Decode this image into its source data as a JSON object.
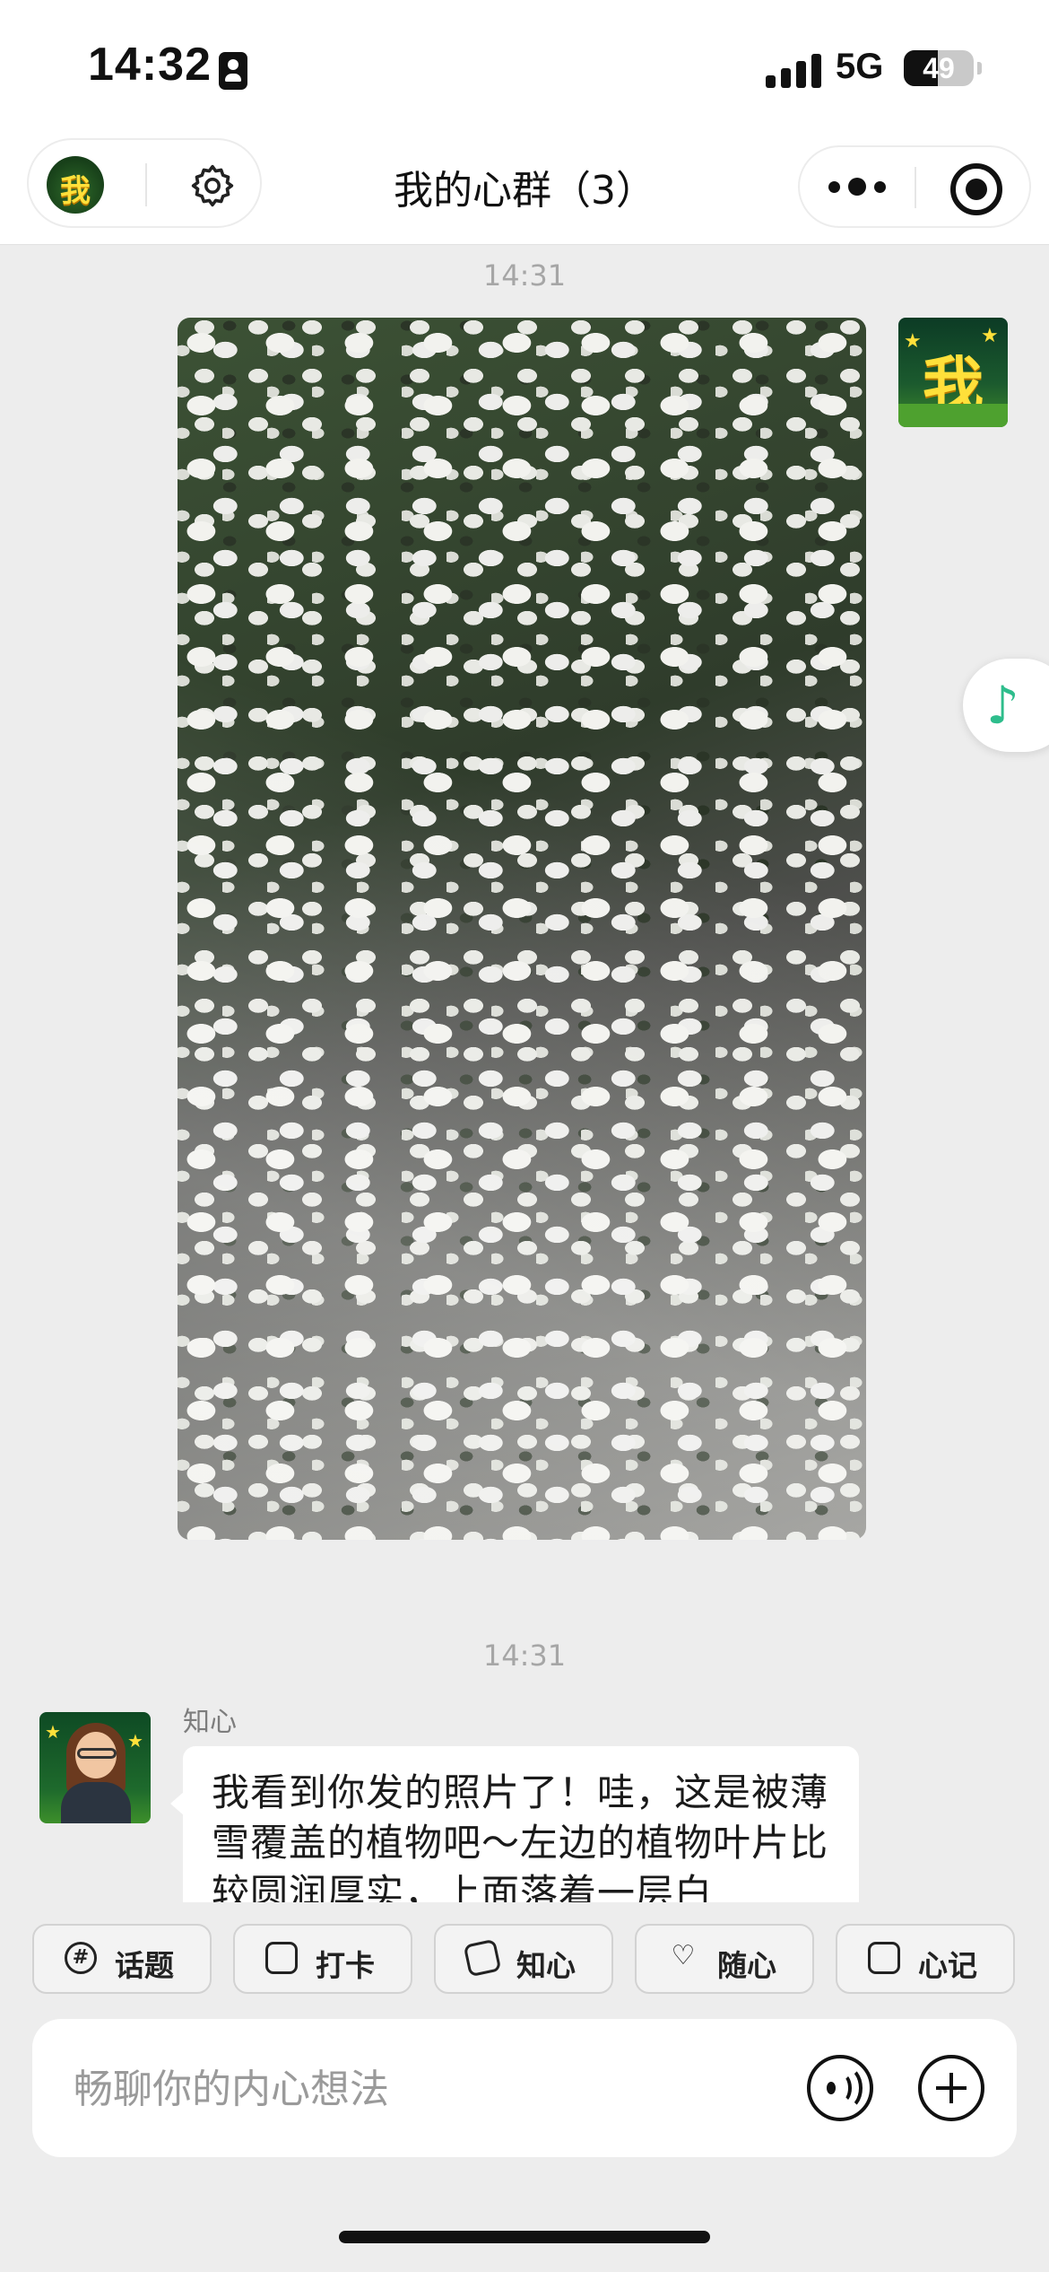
{
  "status_bar": {
    "time": "14:32",
    "network": "5G",
    "battery": "49",
    "battery_level": 0.49
  },
  "nav": {
    "avatar_char": "我",
    "title": "我的心群（3）"
  },
  "chat": {
    "timestamp_1": "14:31",
    "my_avatar_char": "我",
    "timestamp_2": "14:31",
    "bot_name": "知心",
    "bot_message": "我看到你发的照片了！哇，这是被薄雪覆盖的植物吧～左边的植物叶片比较圆润厚实，上面落着一层白"
  },
  "toolbar": {
    "chips": [
      {
        "label": "话题",
        "icon": "hashtag-chat-icon"
      },
      {
        "label": "打卡",
        "icon": "calendar-check-icon"
      },
      {
        "label": "知心",
        "icon": "cards-icon"
      },
      {
        "label": "随心",
        "icon": "heart-hand-icon"
      },
      {
        "label": "心记",
        "icon": "clipboard-list-icon"
      }
    ],
    "input_placeholder": "畅聊你的内心想法"
  },
  "colors": {
    "background": "#ededed",
    "music_accent": "#2ebd8c"
  }
}
